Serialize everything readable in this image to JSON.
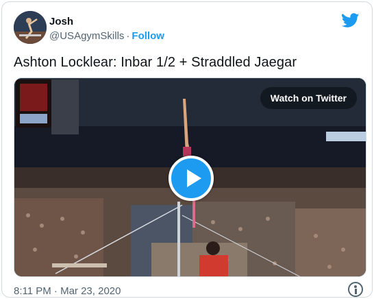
{
  "author": {
    "name": "Josh",
    "handle": "@USAgymSkills",
    "separator": "·",
    "follow_label": "Follow"
  },
  "brand_color": "#1d9bf0",
  "tweet": {
    "text": "Ashton Locklear: Inbar 1/2 + Straddled Jaegar"
  },
  "media": {
    "watch_label": "Watch on Twitter",
    "play_icon": "play-icon"
  },
  "footer": {
    "timestamp": "8:11 PM · Mar 23, 2020",
    "info_icon": "info-icon"
  }
}
